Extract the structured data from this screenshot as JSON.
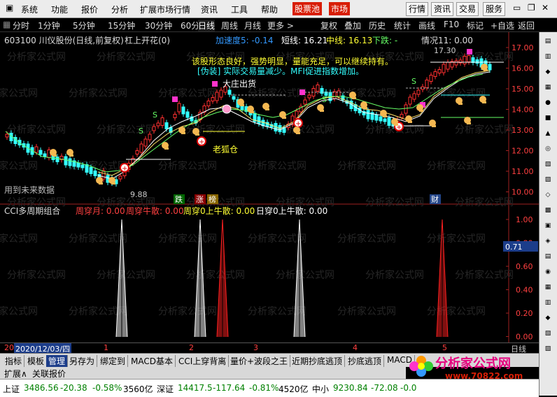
{
  "menu": {
    "items": [
      "系统",
      "功能",
      "报价",
      "分析",
      "扩展市场行情",
      "资讯",
      "工具",
      "帮助"
    ],
    "highlight": [
      "股票池",
      "市场"
    ],
    "right_buttons": [
      "行情",
      "资讯",
      "交易",
      "服务"
    ]
  },
  "toolbar": {
    "periods": [
      "分时",
      "1分钟",
      "5分钟",
      "15分钟",
      "30分钟",
      "60分钟",
      "日线",
      "周线",
      "月线",
      "更多 >"
    ],
    "selected": "日线",
    "actions": [
      "复权",
      "叠加",
      "历史",
      "统计",
      "画线",
      "F10",
      "标记",
      "+自选",
      "返回"
    ]
  },
  "stock": {
    "title": "603100 川仪股份(日线,前复权)",
    "indicator": "杠上开花(0)",
    "accel_label": "加速度5: -0.14",
    "short_label": "短线: 16.21",
    "mid_label": "中线: 16.13",
    "down_label": "下跌: -",
    "status_label": "情况11: 0.00"
  },
  "annotations": {
    "comment1": "该股形态良好，强势明显，量能充足，可以继续持有。",
    "comment2": "[伪装] 实际交易量减少。MFI促进指数增加。",
    "top_signal": "大庄出货",
    "old_fox": "老狐仓",
    "future_data": "用到未来数据",
    "low_price": "9.88",
    "high_price": "17.30",
    "fall_tag": "跌",
    "rise_tag": "涨",
    "list_tag": "榜",
    "fin_tag": "财"
  },
  "price_axis": [
    "17.00",
    "16.00",
    "15.00",
    "14.00",
    "13.00",
    "12.00",
    "11.00",
    "10.00"
  ],
  "cci": {
    "title": "CCI多周期组合",
    "labels": [
      {
        "text": "周穿月: 0.00",
        "color": "#ff4040"
      },
      {
        "text": "周穿牛散: 0.00",
        "color": "#ff4040"
      },
      {
        "text": "周穿0上牛散: 0.00",
        "color": "#ffff33"
      },
      {
        "text": "日穿0上牛散: 0.00",
        "color": "#ffffff"
      }
    ],
    "axis": [
      "1.00",
      "0.80",
      "0.60",
      "0.40",
      "0.20",
      "0.00"
    ],
    "current": "0.71"
  },
  "datebar": {
    "start": "20",
    "date": "2020/12/03/四",
    "months": [
      "1",
      "2",
      "3",
      "4",
      "5"
    ],
    "period": "日线"
  },
  "tabs": [
    "指标",
    "模板",
    "管理",
    "另存为",
    "绑定到",
    "MACD基本",
    "CCI上穿背离",
    "量价+波段之王",
    "近期抄底逃顶",
    "抄底逃顶",
    "MACD"
  ],
  "active_tab": "管理",
  "subtabs": [
    "扩展∧",
    "关联报价"
  ],
  "status_bar": {
    "sh_name": "上证",
    "sh_value": "3486.56",
    "sh_change": "-20.38",
    "sh_pct": "-0.58%",
    "sh_vol": "3560亿",
    "sz_name": "深证",
    "sz_value": "14417.5",
    "sz_change": "-117.64",
    "sz_pct": "-0.81%",
    "sz_vol": "4520亿",
    "sme_name": "中小",
    "sme_value": "9230.84",
    "sme_change": "-72.08",
    "sme_pct": "-0.0"
  },
  "logo": {
    "name": "分析家公式网",
    "url": "www.70822.com"
  },
  "chart_data": {
    "type": "bar",
    "title": "CCI多周期组合",
    "x": [
      1,
      2,
      3,
      4,
      5
    ],
    "series": [
      {
        "name": "周穿月",
        "color": "#ffffff",
        "values": [
          1.0,
          1.0,
          0.0,
          1.0,
          0.0
        ]
      },
      {
        "name": "周穿0上牛散",
        "color": "#ff2020",
        "values": [
          0.0,
          0.0,
          1.0,
          0.0,
          1.0
        ]
      }
    ],
    "ylim": [
      0,
      1
    ]
  }
}
